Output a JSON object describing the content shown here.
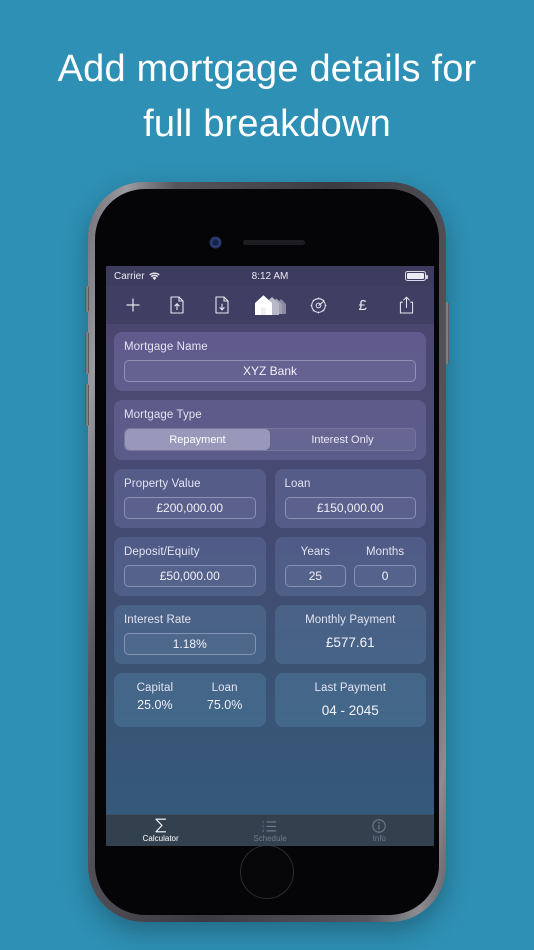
{
  "promo": {
    "headline_line1": "Add mortgage details for",
    "headline_line2": "full breakdown",
    "background_color": "#2e90b4",
    "text_color": "#ffffff"
  },
  "status_bar": {
    "carrier": "Carrier",
    "wifi_icon": "wifi-icon",
    "time": "8:12 AM",
    "battery_icon": "battery-full-icon"
  },
  "toolbar": {
    "items": [
      {
        "name": "add-mortgage-button",
        "icon": "plus-icon",
        "label": "+"
      },
      {
        "name": "export-document-button",
        "icon": "document-upload-icon",
        "label": ""
      },
      {
        "name": "import-document-button",
        "icon": "document-download-icon",
        "label": ""
      },
      {
        "name": "mortgages-button",
        "icon": "house-stack-icon",
        "label": "",
        "selected": true
      },
      {
        "name": "settings-button",
        "icon": "gear-icon",
        "label": ""
      },
      {
        "name": "currency-button",
        "icon": "pound-icon",
        "label": "£"
      },
      {
        "name": "share-button",
        "icon": "share-icon",
        "label": ""
      }
    ]
  },
  "form": {
    "mortgage_name": {
      "label": "Mortgage Name",
      "value": "XYZ Bank",
      "placeholder": "Mortgage Name"
    },
    "mortgage_type": {
      "label": "Mortgage Type",
      "options": [
        "Repayment",
        "Interest Only"
      ],
      "selected": "Repayment"
    },
    "property_value": {
      "label": "Property Value",
      "value": "£200,000.00"
    },
    "loan": {
      "label": "Loan",
      "value": "£150,000.00"
    },
    "deposit_equity": {
      "label": "Deposit/Equity",
      "value": "£50,000.00"
    },
    "term": {
      "years_label": "Years",
      "years_value": "25",
      "months_label": "Months",
      "months_value": "0"
    },
    "interest_rate": {
      "label": "Interest Rate",
      "value": "1.18%"
    },
    "monthly_payment": {
      "label": "Monthly Payment",
      "value": "£577.61"
    },
    "breakdown": {
      "capital_label": "Capital",
      "capital_value": "25.0%",
      "loan_label": "Loan",
      "loan_value": "75.0%"
    },
    "last_payment": {
      "label": "Last Payment",
      "value": "04 - 2045"
    }
  },
  "tab_bar": {
    "tabs": [
      {
        "label": "Calculator",
        "icon": "sigma-icon",
        "active": true
      },
      {
        "label": "Schedule",
        "icon": "list-icon",
        "active": false
      },
      {
        "label": "Info",
        "icon": "info-circle-icon",
        "active": false
      }
    ]
  }
}
